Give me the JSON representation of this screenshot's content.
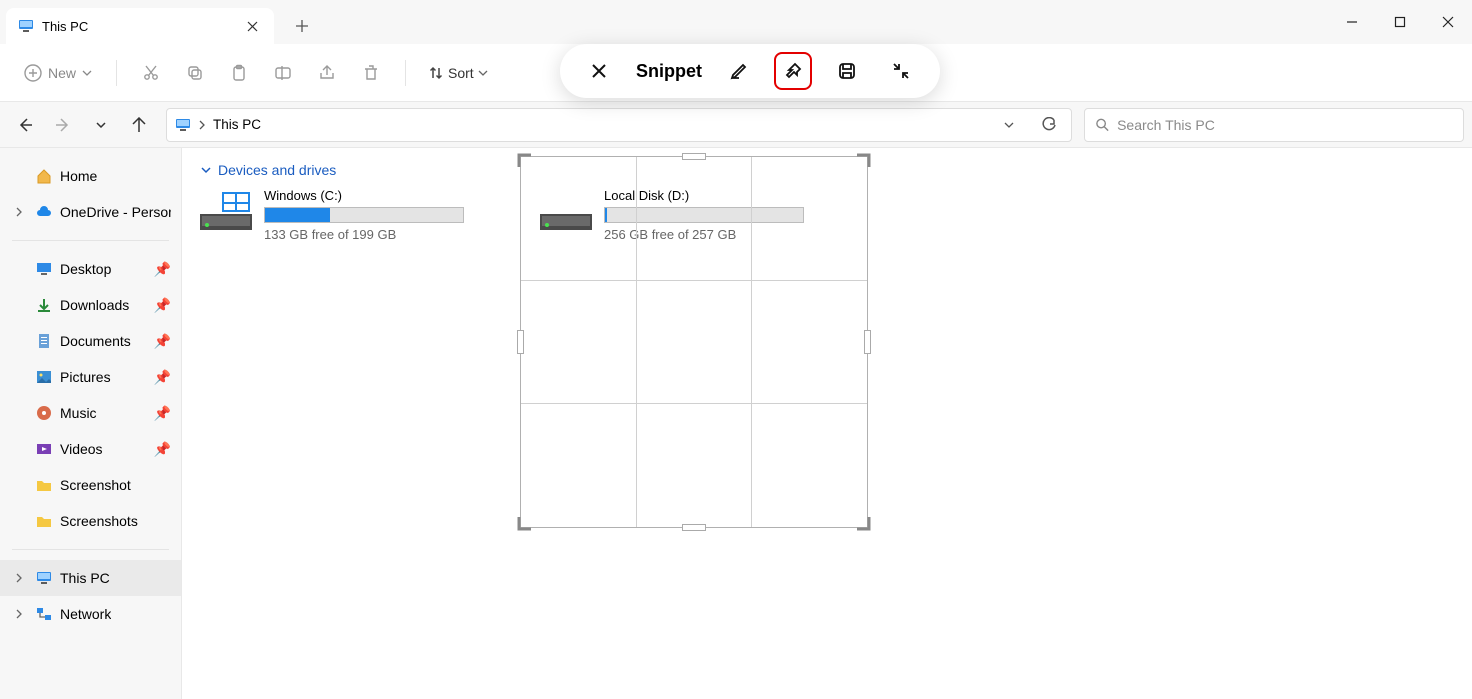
{
  "window": {
    "tab_title": "This PC",
    "new_label": "New",
    "sort_label": "Sort",
    "breadcrumb_root": "This PC",
    "search_placeholder": "Search This PC"
  },
  "snippet": {
    "label": "Snippet"
  },
  "sidebar": {
    "home": "Home",
    "onedrive": "OneDrive - Personal",
    "desktop": "Desktop",
    "downloads": "Downloads",
    "documents": "Documents",
    "pictures": "Pictures",
    "music": "Music",
    "videos": "Videos",
    "screenshot": "Screenshot",
    "screenshots": "Screenshots",
    "thispc": "This PC",
    "network": "Network"
  },
  "content": {
    "group_header": "Devices and drives",
    "drives": [
      {
        "name": "Windows (C:)",
        "free": "133 GB free of 199 GB",
        "fill_pct": 33
      },
      {
        "name": "Local Disk (D:)",
        "free": "256 GB free of 257 GB",
        "fill_pct": 1
      }
    ]
  }
}
